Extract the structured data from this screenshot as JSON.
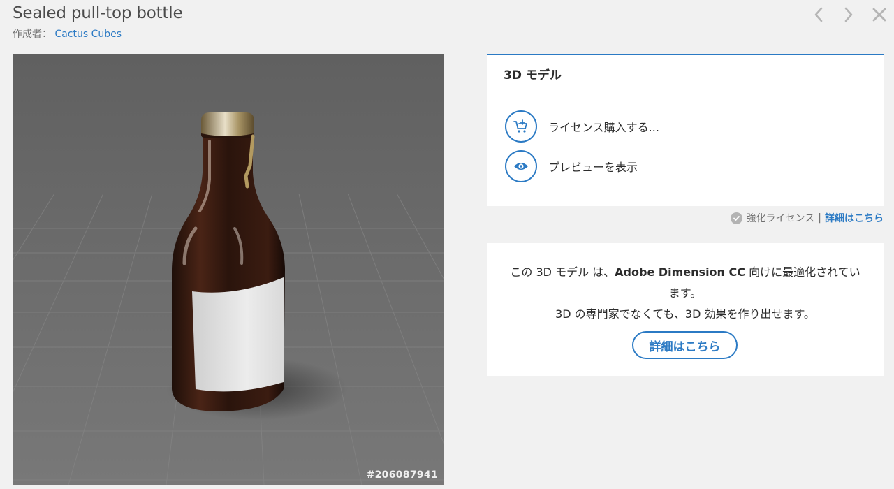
{
  "header": {
    "title": "Sealed pull-top bottle",
    "author_prefix": "作成者：",
    "author_name": "Cactus Cubes"
  },
  "preview": {
    "asset_id": "#206087941"
  },
  "model_panel": {
    "title": "3D モデル",
    "license_label": "ライセンス購入する...",
    "preview_label": "プレビューを表示"
  },
  "license_info": {
    "text": "強化ライセンス",
    "separator": "|",
    "link": "詳細はこちら"
  },
  "info_box": {
    "line1_pre": "この 3D モデル は、",
    "line1_brand": "Adobe Dimension CC",
    "line1_post": " 向けに最適化されています。",
    "line2": "3D の専門家でなくても、3D 効果を作り出せます。",
    "button": "詳細はこちら"
  },
  "colors": {
    "accent": "#2b7ac4",
    "background": "#f1f1f1"
  },
  "icons": {
    "prev": "chevron-left-icon",
    "next": "chevron-right-icon",
    "close": "close-icon",
    "cart": "cart-add-icon",
    "eye": "eye-icon",
    "check": "check-circle-icon"
  }
}
